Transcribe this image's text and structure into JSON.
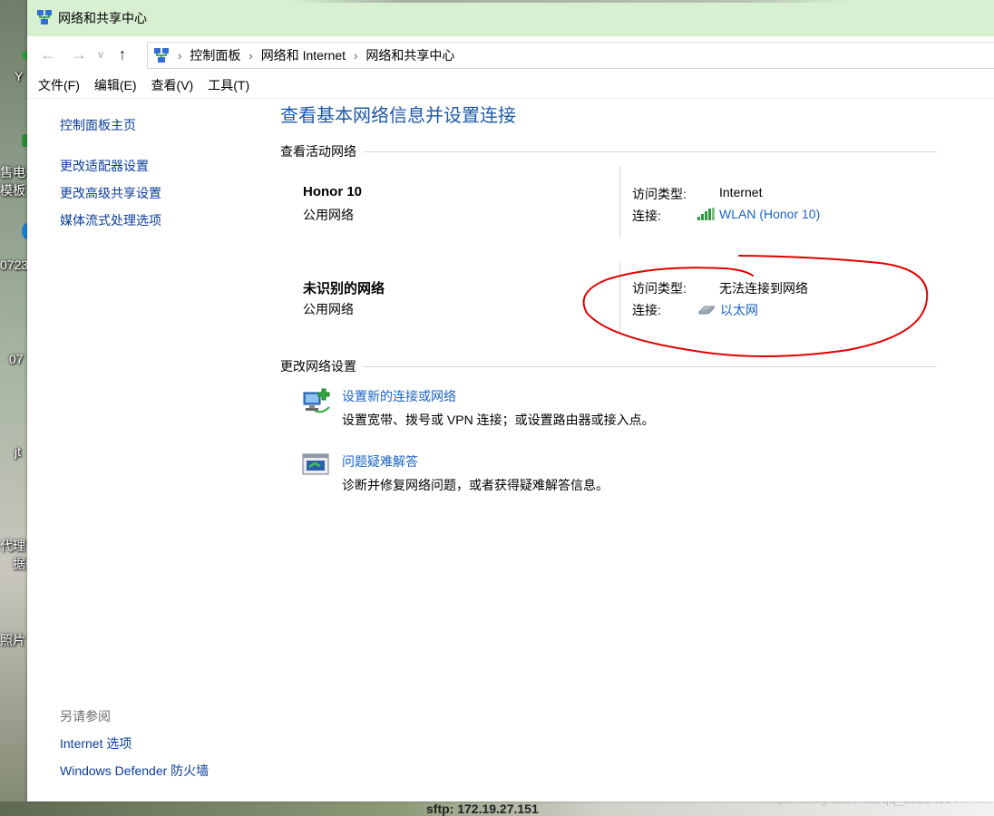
{
  "window": {
    "title": "网络和共享中心"
  },
  "address_bar": {
    "crumbs": [
      "控制面板",
      "网络和 Internet",
      "网络和共享中心"
    ]
  },
  "menu": [
    "文件(F)",
    "编辑(E)",
    "查看(V)",
    "工具(T)"
  ],
  "left_pane": {
    "home": "控制面板主页",
    "links": [
      "更改适配器设置",
      "更改高级共享设置",
      "媒体流式处理选项"
    ],
    "see_also_title": "另请参阅",
    "see_also": [
      "Internet 选项",
      "Windows Defender 防火墙"
    ]
  },
  "main": {
    "title": "查看基本网络信息并设置连接",
    "active_networks_heading": "查看活动网络",
    "networks": [
      {
        "name": "Honor 10",
        "type": "公用网络",
        "access_label": "访问类型:",
        "access_value": "Internet",
        "conn_label": "连接:",
        "conn_value": "WLAN (Honor 10)",
        "conn_icon": "wifi-signal-icon"
      },
      {
        "name": "未识别的网络",
        "type": "公用网络",
        "access_label": "访问类型:",
        "access_value": "无法连接到网络",
        "conn_label": "连接:",
        "conn_value": "以太网",
        "conn_icon": "ethernet-icon"
      }
    ],
    "change_settings_heading": "更改网络设置",
    "tasks": [
      {
        "link": "设置新的连接或网络",
        "desc": "设置宽带、拨号或 VPN 连接；或设置路由器或接入点。",
        "icon": "new-connection-icon"
      },
      {
        "link": "问题疑难解答",
        "desc": "诊断并修复网络问题，或者获得疑难解答信息。",
        "icon": "troubleshoot-icon"
      }
    ]
  },
  "desktop": {
    "labels": [
      "Y",
      "售电",
      "模板",
      "0723",
      "07",
      "jt",
      "代理",
      "据",
      "照片"
    ]
  },
  "background_text": {
    "sftp": "sftp: 172.19.27.151",
    "watermark": "https://blog.csdn.net/qq_38254997"
  },
  "colors": {
    "titlebar": "#d7f0d2",
    "link": "#1a63c4",
    "page_title": "#1e5aa8",
    "annotation": "#e00000"
  }
}
